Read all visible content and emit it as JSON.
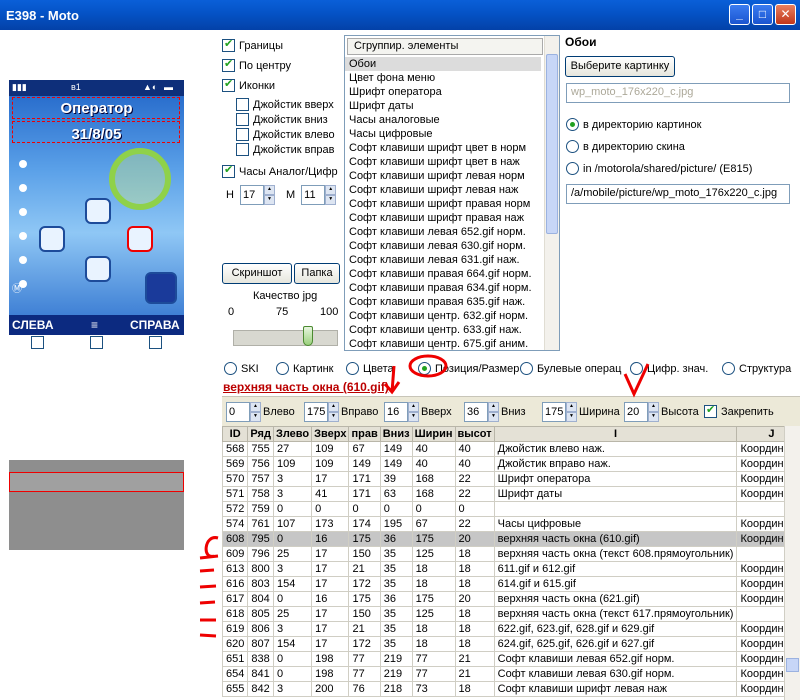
{
  "window": {
    "title": "E398 - Moto"
  },
  "phone": {
    "operator": "Оператор",
    "date": "31/8/05",
    "left_soft": "СЛЕВА",
    "right_soft": "СПРАВА"
  },
  "options": {
    "borders": "Границы",
    "center": "По центру",
    "icons": "Иконки",
    "joy_up": "Джойстик вверх",
    "joy_down": "Джойстик вниз",
    "joy_left": "Джойстик влево",
    "joy_right": "Джойстик вправ",
    "clock": "Часы Аналог/Цифр",
    "h_label": "H",
    "h_value": "17",
    "m_label": "M",
    "m_value": "11"
  },
  "buttons": {
    "screenshot": "Скриншот",
    "folder": "Папка",
    "choose_image": "Выберите картинку"
  },
  "quality": {
    "label": "Качество jpg",
    "min": "0",
    "mid": "75",
    "max": "100"
  },
  "elements": {
    "header": "Сгруппир. элементы",
    "items": [
      "Обои",
      "Цвет фона меню",
      "Шрифт оператора",
      "Шрифт даты",
      "Часы аналоговые",
      "Часы цифровые",
      "Софт клавиши шрифт цвет в норм",
      "Софт клавиши шрифт цвет в наж",
      "Софт клавиши шрифт левая норм",
      "Софт клавиши шрифт левая наж",
      "Софт клавиши шрифт правая норм",
      "Софт клавиши шрифт правая наж",
      "Софт клавиши левая 652.gif норм.",
      "Софт клавиши левая 630.gif норм.",
      "Софт клавиши левая 631.gif наж.",
      "Софт клавиши правая 664.gif норм.",
      "Софт клавиши правая 634.gif норм.",
      "Софт клавиши правая 635.gif наж.",
      "Софт клавиши центр. 632.gif норм.",
      "Софт клавиши центр. 633.gif наж.",
      "Софт клавиши центр. 675.gif аним."
    ]
  },
  "wallpaper": {
    "title": "Обои",
    "filename": "wp_moto_176x220_c.jpg",
    "radio_images": "в директорию картинок",
    "radio_skin": "в директорию скина",
    "radio_path": "in /motorola/shared/picture/ (E815)",
    "path": "/a/mobile/picture/wp_moto_176x220_c.jpg"
  },
  "tabs": [
    "SKI",
    "Картинк",
    "Цвета",
    "Позиция/Размер",
    "Булевые операц",
    "Цифр. знач.",
    "Структура"
  ],
  "section": {
    "title": "верхняя часть окна (610.gif)"
  },
  "position": {
    "left_value": "0",
    "left_label": "Влево",
    "right_value": "175",
    "right_label": "Вправо",
    "top_value": "16",
    "top_label": "Вверх",
    "bottom_value": "36",
    "bottom_label": "Вниз",
    "width_value": "175",
    "width_label": "Ширина",
    "height_value": "20",
    "height_label": "Высота",
    "lock_label": "Закрепить"
  },
  "table": {
    "columns": [
      "ID",
      "Ряд",
      "Злево",
      "Зверх",
      "прав",
      "Вниз",
      "Ширин",
      "высот",
      "I",
      "J"
    ],
    "rows": [
      [
        "568",
        "755",
        "27",
        "109",
        "67",
        "149",
        "40",
        "40",
        "Джойстик влево наж.",
        "Координаты"
      ],
      [
        "569",
        "756",
        "109",
        "109",
        "149",
        "149",
        "40",
        "40",
        "Джойстик вправо наж.",
        "Координаты"
      ],
      [
        "570",
        "757",
        "3",
        "17",
        "171",
        "39",
        "168",
        "22",
        "Шрифт оператора",
        "Координаты"
      ],
      [
        "571",
        "758",
        "3",
        "41",
        "171",
        "63",
        "168",
        "22",
        "Шрифт даты",
        "Координаты"
      ],
      [
        "572",
        "759",
        "0",
        "0",
        "0",
        "0",
        "0",
        "0",
        "",
        ""
      ],
      [
        "574",
        "761",
        "107",
        "173",
        "174",
        "195",
        "67",
        "22",
        "Часы цифровые",
        "Координаты"
      ],
      [
        "608",
        "795",
        "0",
        "16",
        "175",
        "36",
        "175",
        "20",
        "верхняя часть окна (610.gif)",
        "Координаты"
      ],
      [
        "609",
        "796",
        "25",
        "17",
        "150",
        "35",
        "125",
        "18",
        "верхняя часть окна (текст 608.прямоугольник)",
        ""
      ],
      [
        "613",
        "800",
        "3",
        "17",
        "21",
        "35",
        "18",
        "18",
        "611.gif и 612.gif",
        "Координаты"
      ],
      [
        "616",
        "803",
        "154",
        "17",
        "172",
        "35",
        "18",
        "18",
        "614.gif и 615.gif",
        "Координаты"
      ],
      [
        "617",
        "804",
        "0",
        "16",
        "175",
        "36",
        "175",
        "20",
        "верхняя часть окна (621.gif)",
        "Координаты"
      ],
      [
        "618",
        "805",
        "25",
        "17",
        "150",
        "35",
        "125",
        "18",
        "верхняя часть окна (текст 617.прямоугольник)",
        ""
      ],
      [
        "619",
        "806",
        "3",
        "17",
        "21",
        "35",
        "18",
        "18",
        "622.gif, 623.gif, 628.gif и 629.gif",
        "Координаты"
      ],
      [
        "620",
        "807",
        "154",
        "17",
        "172",
        "35",
        "18",
        "18",
        "624.gif, 625.gif, 626.gif и 627.gif",
        "Координаты"
      ],
      [
        "651",
        "838",
        "0",
        "198",
        "77",
        "219",
        "77",
        "21",
        "Софт клавиши левая 652.gif норм.",
        "Координаты"
      ],
      [
        "654",
        "841",
        "0",
        "198",
        "77",
        "219",
        "77",
        "21",
        "Софт клавиши левая 630.gif норм.",
        "Координаты"
      ],
      [
        "655",
        "842",
        "3",
        "200",
        "76",
        "218",
        "73",
        "18",
        "Софт клавиши шрифт левая наж",
        "Координаты"
      ]
    ]
  },
  "colors": {
    "title_bar": "#0554c8",
    "accent_red": "#e00000",
    "section_title": "#b00000",
    "check_green": "#21a121"
  }
}
